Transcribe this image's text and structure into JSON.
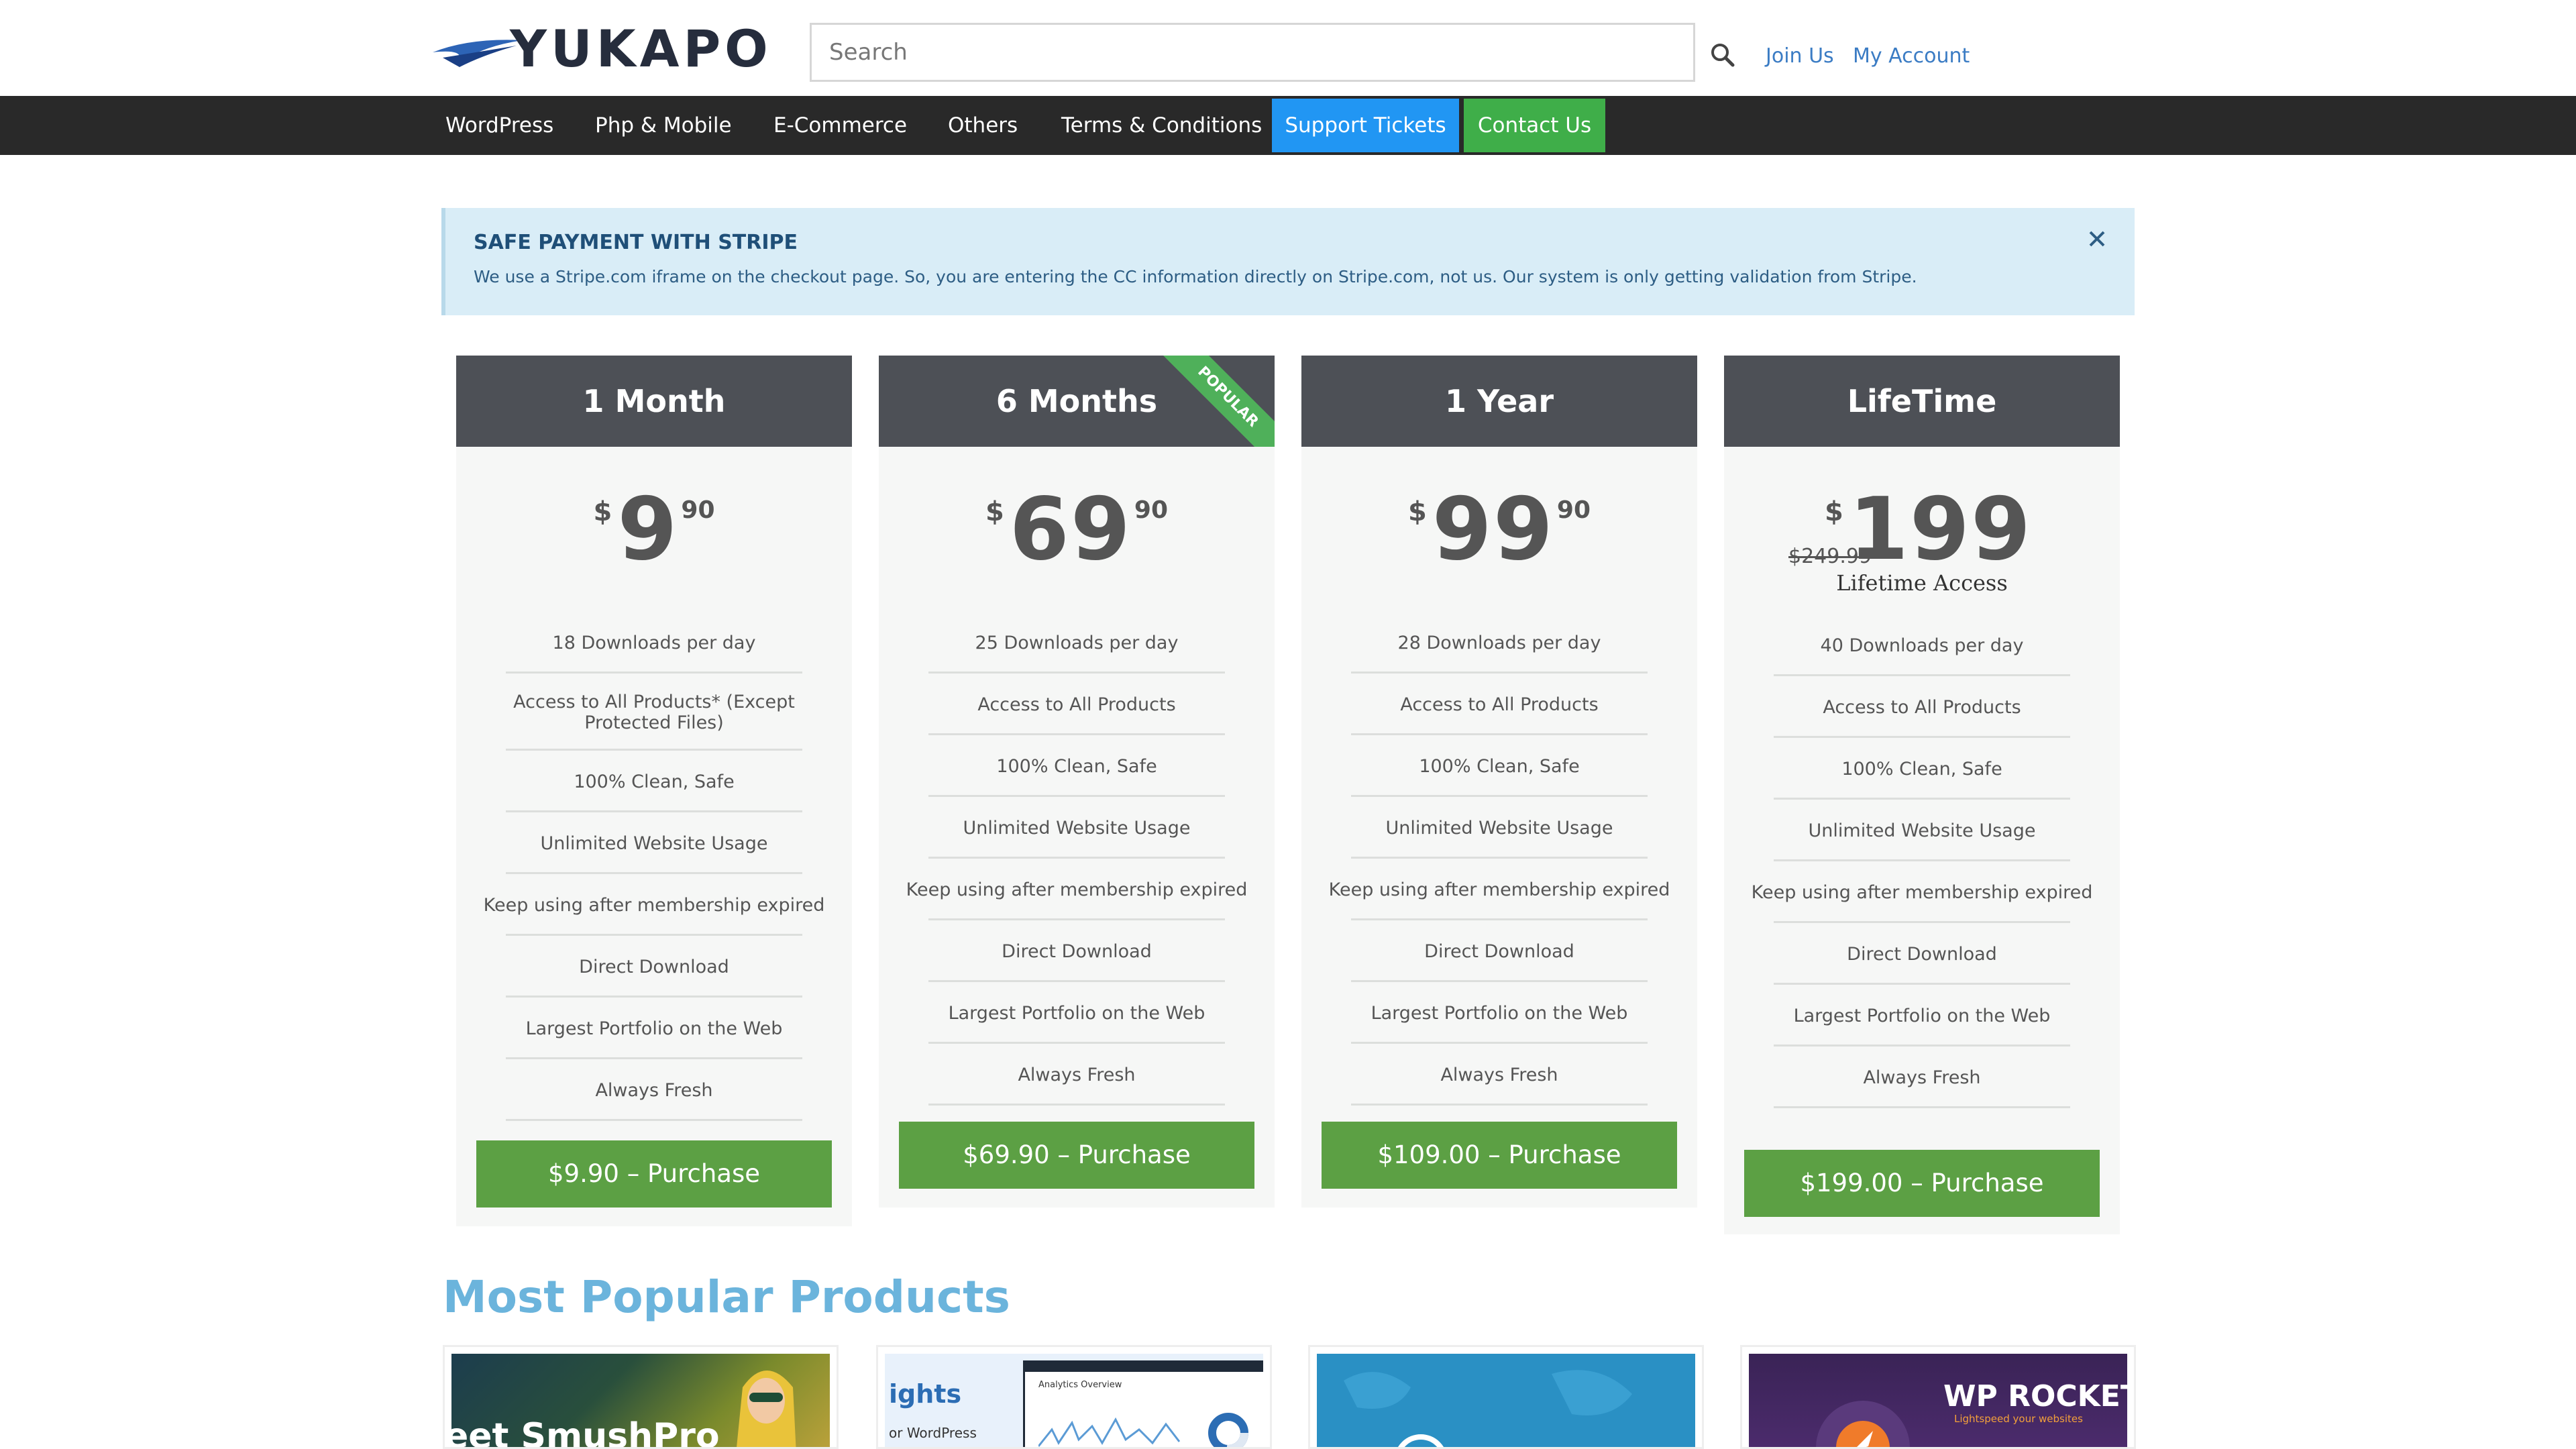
{
  "header": {
    "logo_text": "YUKAPO",
    "search_placeholder": "Search",
    "join_label": "Join Us",
    "account_label": "My Account"
  },
  "nav": {
    "items": [
      "WordPress",
      "Php & Mobile",
      "E-Commerce",
      "Others",
      "Terms & Conditions"
    ],
    "support_label": "Support Tickets",
    "contact_label": "Contact Us"
  },
  "alert": {
    "title": "SAFE PAYMENT WITH STRIPE",
    "text": "We use a Stripe.com iframe on the checkout page. So, you are entering the CC information directly on Stripe.com, not us. Our system is only getting validation from Stripe."
  },
  "plans": [
    {
      "name": "1 Month",
      "currency": "$",
      "price": "9",
      "cents": "90",
      "features": [
        "18 Downloads per day",
        "Access to All Products* (Except Protected Files)",
        "100% Clean, Safe",
        "Unlimited Website Usage",
        "Keep using after membership expired",
        "Direct Download",
        "Largest Portfolio on the Web",
        "Always Fresh"
      ],
      "button": "$9.90 – Purchase"
    },
    {
      "name": "6 Months",
      "currency": "$",
      "price": "69",
      "cents": "90",
      "ribbon": "POPULAR",
      "features": [
        "25 Downloads per day",
        "Access to All Products",
        "100% Clean, Safe",
        "Unlimited Website Usage",
        "Keep using after membership expired",
        "Direct Download",
        "Largest Portfolio on the Web",
        "Always Fresh"
      ],
      "button": "$69.90 – Purchase"
    },
    {
      "name": "1 Year",
      "currency": "$",
      "price": "99",
      "cents": "90",
      "features": [
        "28 Downloads per day",
        "Access to All Products",
        "100% Clean, Safe",
        "Unlimited Website Usage",
        "Keep using after membership expired",
        "Direct Download",
        "Largest Portfolio on the Web",
        "Always Fresh"
      ],
      "button": "$109.00 – Purchase"
    },
    {
      "name": "LifeTime",
      "currency": "$",
      "price": "199",
      "old_price": "$249.99",
      "label": "Lifetime Access",
      "features": [
        "40 Downloads per day",
        "Access to All Products",
        "100% Clean, Safe",
        "Unlimited Website Usage",
        "Keep using after membership expired",
        "Direct Download",
        "Largest Portfolio on the Web",
        "Always Fresh"
      ],
      "button": "$199.00 – Purchase"
    }
  ],
  "popular": {
    "title": "Most Popular Products",
    "products": [
      {
        "thumb_text": "eet SmushPro"
      },
      {
        "thumb_text": "ights",
        "thumb_sub": "or WordPress",
        "thumb_panel": "Analytics Overview"
      },
      {
        "thumb_text": ""
      },
      {
        "thumb_text": "WP ROCKET",
        "thumb_sub": "Lightspeed your websites"
      }
    ]
  },
  "colors": {
    "nav_bg": "#292929",
    "support_btn": "#2196f3",
    "contact_btn": "#3fae49",
    "purchase_btn": "#5ca044",
    "card_head": "#4d5056",
    "section_title": "#6bb4dc"
  }
}
